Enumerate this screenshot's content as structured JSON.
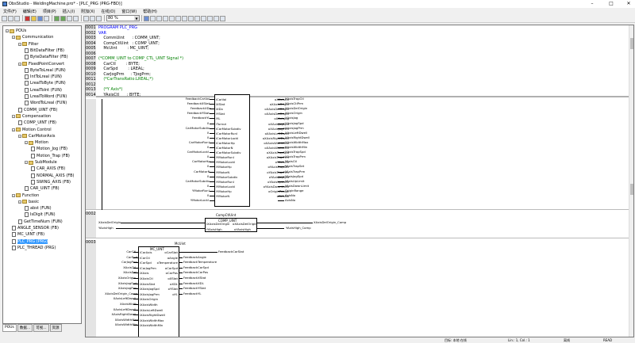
{
  "window": {
    "title": "ObsStudio - WeldingMachine.pro* - [PLC_PRG (PRG-FBD)]",
    "min": "–",
    "max": "□",
    "close": "✕"
  },
  "menu": [
    "文件(F)",
    "编辑(E)",
    "项目(P)",
    "插入(I)",
    "附加(X)",
    "在线(O)",
    "窗口(W)",
    "帮助(H)"
  ],
  "toolbar": {
    "zoom": "80 %"
  },
  "tree": {
    "tabs": [
      "POUs",
      "数据...",
      "可视...",
      "资源"
    ],
    "nodes": [
      {
        "label": "POUs",
        "depth": 0,
        "kind": "folder",
        "pm": "-"
      },
      {
        "label": "Communication",
        "depth": 1,
        "kind": "folder",
        "pm": "-"
      },
      {
        "label": "Filter",
        "depth": 2,
        "kind": "folder",
        "pm": "-"
      },
      {
        "label": "BitDataFilter (FB)",
        "depth": 3,
        "kind": "pou"
      },
      {
        "label": "ByteDataFilter (FB)",
        "depth": 3,
        "kind": "pou"
      },
      {
        "label": "FixedPointConvert",
        "depth": 2,
        "kind": "folder",
        "pm": "-"
      },
      {
        "label": "ByteToLreal (FUN)",
        "depth": 3,
        "kind": "pou"
      },
      {
        "label": "IntToLreal (FUN)",
        "depth": 3,
        "kind": "pou"
      },
      {
        "label": "LrealToByte (FUN)",
        "depth": 3,
        "kind": "pou"
      },
      {
        "label": "LrealToInt (FUN)",
        "depth": 3,
        "kind": "pou"
      },
      {
        "label": "LrealToWord (FUN)",
        "depth": 3,
        "kind": "pou"
      },
      {
        "label": "WordToLreal (FUN)",
        "depth": 3,
        "kind": "pou"
      },
      {
        "label": "COMM_UINT (FB)",
        "depth": 2,
        "kind": "pou"
      },
      {
        "label": "Compensation",
        "depth": 1,
        "kind": "folder",
        "pm": "-"
      },
      {
        "label": "COMP_UINT (FB)",
        "depth": 2,
        "kind": "pou"
      },
      {
        "label": "Motion Control",
        "depth": 1,
        "kind": "folder",
        "pm": "-"
      },
      {
        "label": "CarMotorAxis",
        "depth": 2,
        "kind": "folder",
        "pm": "-"
      },
      {
        "label": "Motion",
        "depth": 3,
        "kind": "folder",
        "pm": "-"
      },
      {
        "label": "Motion_Jog (FB)",
        "depth": 4,
        "kind": "pou"
      },
      {
        "label": "Motion_Trap (FB)",
        "depth": 4,
        "kind": "pou"
      },
      {
        "label": "SubModule",
        "depth": 3,
        "kind": "folder",
        "pm": "-"
      },
      {
        "label": "CAR_AXIS (FB)",
        "depth": 4,
        "kind": "pou"
      },
      {
        "label": "NORMAL_AXIS (FB)",
        "depth": 4,
        "kind": "pou"
      },
      {
        "label": "SWING_AXIS (FB)",
        "depth": 4,
        "kind": "pou"
      },
      {
        "label": "CAR_UINT (FB)",
        "depth": 3,
        "kind": "pou"
      },
      {
        "label": "Function",
        "depth": 1,
        "kind": "folder",
        "pm": "-"
      },
      {
        "label": "basic",
        "depth": 2,
        "kind": "folder",
        "pm": "-"
      },
      {
        "label": "abst (FUN)",
        "depth": 3,
        "kind": "pou"
      },
      {
        "label": "IsDigit (FUN)",
        "depth": 3,
        "kind": "pou"
      },
      {
        "label": "GetTimeNum (FUN)",
        "depth": 2,
        "kind": "pou"
      },
      {
        "label": "ANGLE_SENSOR (FB)",
        "depth": 1,
        "kind": "pou"
      },
      {
        "label": "MC_UINT (FB)",
        "depth": 1,
        "kind": "pou"
      },
      {
        "label": "PLC_PRG (PRG)",
        "depth": 1,
        "kind": "pou",
        "selected": true
      },
      {
        "label": "PLC_THREAD (PRG)",
        "depth": 1,
        "kind": "pou"
      }
    ]
  },
  "decl": [
    {
      "n": "0001",
      "t": "PROGRAM PLC_PRG",
      "c": "kw"
    },
    {
      "n": "0002",
      "t": "VAR",
      "c": "kw"
    },
    {
      "n": "0003",
      "t": "    CommUint      : COMM_UINT;",
      "c": ""
    },
    {
      "n": "0004",
      "t": "    CompCtlUint   : COMP_UINT;",
      "c": ""
    },
    {
      "n": "0005",
      "t": "    McUint        : MC_UINT;",
      "c": ""
    },
    {
      "n": "0006",
      "t": "",
      "c": ""
    },
    {
      "n": "0007",
      "t": "(*COMM_UINT to COMP_CTL_UINT Signal *)",
      "c": "cm"
    },
    {
      "n": "0008",
      "t": "    CarCtl        : BYTE;",
      "c": ""
    },
    {
      "n": "0009",
      "t": "    CarSpd        : LREAL;",
      "c": ""
    },
    {
      "n": "0010",
      "t": "    CarJogPrm     : TJogPrm;",
      "c": ""
    },
    {
      "n": "0011",
      "t": "    (*CarTransRatio:LREAL;*)",
      "c": "cm"
    },
    {
      "n": "0012",
      "t": "",
      "c": ""
    },
    {
      "n": "0013",
      "t": "    (*Y Axis*)",
      "c": "cm"
    },
    {
      "n": "0014",
      "t": "    YAxisCtl      : BYTE;",
      "c": ""
    }
  ],
  "net1": {
    "left": [
      "FeedbackCarVol",
      "FeedbackXStat",
      "FeedbackXDx",
      "FeedbackYStat",
      "FeedbackYL",
      "0",
      "CarMotorSubdiv",
      "0",
      "0",
      "CarMotorRunI",
      "0",
      "CarMotorLockI",
      "0",
      "CarMotorHp",
      "0",
      "CarMotorN",
      "0",
      "CarMotorSubdiv",
      "0",
      "YMotorRunI",
      "0",
      "YMotorLockI",
      "0",
      "YMotorHp",
      "0",
      "YMotorN",
      "0",
      "YMotorSubdiv",
      "0",
      "YMotorRunI",
      "0",
      "YMotorLockI",
      "0",
      "YMotorHp",
      "0",
      "YMotorN"
    ],
    "inner_l": [
      "iCarVol",
      "iXStat",
      "iXDx",
      "iYStat",
      "iYL",
      "iTurnut",
      "iCarMotorSubdiv",
      "iCarMotorRunI",
      "iCarMotorLockI",
      "iCarMotorHp",
      "iCarMotorN",
      "iCarMotorSubdiv",
      "iYMotorRunI",
      "iYMotorLockI",
      "iYMotorHp",
      "iYMotorN",
      "iYMotorSubdiv",
      "iYMotorRunI",
      "iYMotorLockI",
      "iYMotorHp",
      "iYMotorN"
    ],
    "inner_r": [
      "oXAxisCtl",
      "oXAxisOrigin",
      "oXAxisDelOrigin",
      "oXAxisDelOrigin",
      "oXAxisJog",
      "oXAxisJogSpd",
      "oXAxisJogPrm",
      "oXAxisLeftDwell",
      "oXAxisRightDwell",
      "oXAxisWidthMax",
      "oXAxisWidthMin",
      "oXAxisTrapSpd",
      "oXAxisTrapPrm",
      "oYAxisCtl",
      "oYAxisTrapSet",
      "oYAxisTrapPrm",
      "oYAxisJogSpd",
      "oYAxisUpLimit",
      "oYAxisDownLimit",
      "oOriginRange",
      "oAxisNo"
    ],
    "right": [
      "XAxisTrapCtl",
      "XAxisCtlPrm",
      "XAxisDelOrigin",
      "XAxisOrigin",
      "XAxisJog",
      "XAxisJogSpd",
      "XAxisJogPrm",
      "XAxisLeftDwell",
      "XAxisRightDwell",
      "XAxisWidthMax",
      "XAxisWidthMin",
      "XAxisTrapSpd",
      "XAxisTrapPrm",
      "YAxisCtl",
      "YAxisTrapSet",
      "YAxisTrapPrm",
      "YAxisJogSpd",
      "YAxisUpLimit",
      "YAxisDownLimit",
      "OriginRange",
      "AxisNo",
      "AxisNo"
    ]
  },
  "net2": {
    "num": "0002",
    "inst": "CompCtlUint",
    "type": "COMP_UINT",
    "in1": "XAxisDelOrigin",
    "in1p": "iXAxisDelOrigin",
    "out1p": "oXAxisDelOrigin",
    "out1": "XAxisDelOrigin_Comp",
    "in2": "YAxisHigh",
    "in2p": "iYAxisHigh",
    "out2p": "oYAxisHigh",
    "out2": "YAxisHigh_Comp"
  },
  "net3": {
    "num": "0003",
    "inst": "McUint",
    "type": "MC_UINT",
    "left": [
      "CarCtl",
      "CarSpd",
      "CarJogPrm",
      "XAxisCtl",
      "XAxisDel",
      "XAxisOrigin",
      "XAxisJogSpd",
      "XAxisJogPrm",
      "XAxisDelOrigin_Comp",
      "XAxisLeftDwell",
      "XAxisWidth",
      "XAxisLeftDwell",
      "XAxisRightDwell",
      "XAxisWidthMax",
      "XAxisWidthMin"
    ],
    "inner_l": [
      "iCarAxis",
      "iCarCtl",
      "iCarSpd",
      "iCarJogPrm",
      "iXAxis",
      "iXAxisCtl",
      "iXAxisStat",
      "iXAxisJogSpd",
      "iXAxisJogPrm",
      "iXAxisOrigin",
      "iXAxisWidth",
      "iXAxisLeftDwell",
      "iXAxisRightDwell",
      "iXAxisWidthMax",
      "iXAxisWidthMin"
    ],
    "inner_r": [
      "oCarStat",
      "oAngle",
      "oTemperature",
      "oCarSpd",
      "oCarPos",
      "oXStat",
      "oXDL",
      "oYStat",
      "oYL"
    ],
    "right": [
      "FeedbackCarStat",
      "FeedbackAngle",
      "FeedbackTemperature",
      "FeedbackCarSpd",
      "FeedbackCarPos",
      "FeedbackXStat",
      "FeedbackXDL",
      "FeedbackYStat",
      "FeedbackYL"
    ]
  },
  "status": {
    "s1": "目标: 本地  在线",
    "s2": "Lin.: 1, Col.: 1",
    "s3": "离线",
    "s4": "READ"
  }
}
